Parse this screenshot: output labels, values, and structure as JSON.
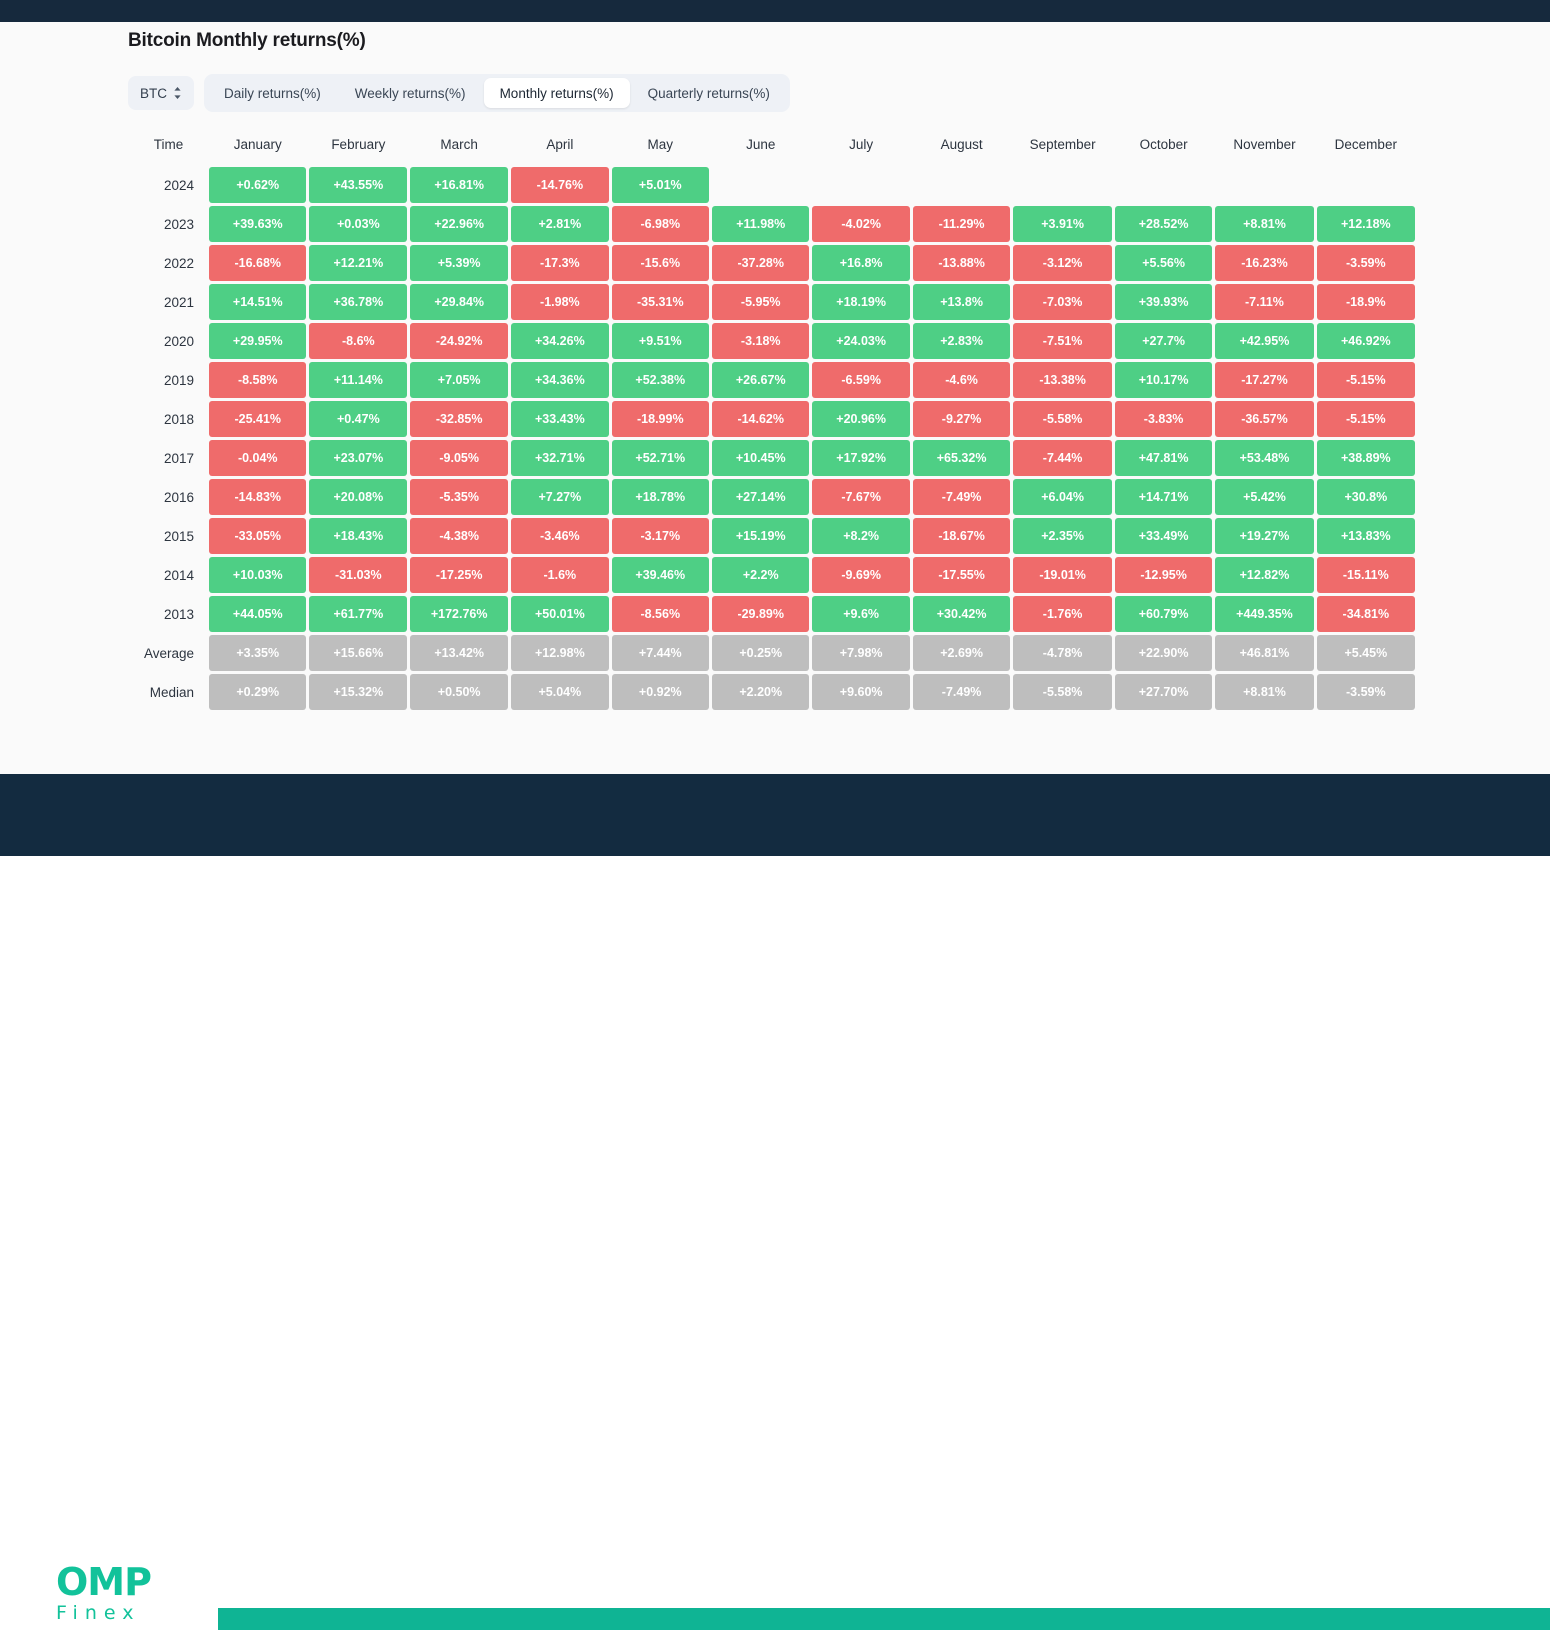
{
  "title": "Bitcoin Monthly returns(%)",
  "controls": {
    "asset": "BTC",
    "asset_icon": "chevron-up-down-icon",
    "tabs": [
      {
        "label": "Daily returns(%)",
        "active": false
      },
      {
        "label": "Weekly returns(%)",
        "active": false
      },
      {
        "label": "Monthly returns(%)",
        "active": true
      },
      {
        "label": "Quarterly returns(%)",
        "active": false
      }
    ]
  },
  "colors": {
    "positive": "#4ecf85",
    "negative": "#ef6b6b",
    "stat": "#bebebe",
    "brand": "#12c29a",
    "navy": "#16293d",
    "teal_band": "#0fb494"
  },
  "logo": {
    "name": "OMP",
    "sub": "Finex"
  },
  "chart_data": {
    "type": "heatmap",
    "title": "Bitcoin Monthly returns(%)",
    "xlabel": "",
    "ylabel": "Time",
    "columns": [
      "Time",
      "January",
      "February",
      "March",
      "April",
      "May",
      "June",
      "July",
      "August",
      "September",
      "October",
      "November",
      "December"
    ],
    "categories": [
      "January",
      "February",
      "March",
      "April",
      "May",
      "June",
      "July",
      "August",
      "September",
      "October",
      "November",
      "December"
    ],
    "rows": [
      {
        "label": "2024",
        "kind": "year",
        "values": [
          "+0.62%",
          "+43.55%",
          "+16.81%",
          "-14.76%",
          "+5.01%",
          "",
          "",
          "",
          "",
          "",
          "",
          ""
        ]
      },
      {
        "label": "2023",
        "kind": "year",
        "values": [
          "+39.63%",
          "+0.03%",
          "+22.96%",
          "+2.81%",
          "-6.98%",
          "+11.98%",
          "-4.02%",
          "-11.29%",
          "+3.91%",
          "+28.52%",
          "+8.81%",
          "+12.18%"
        ]
      },
      {
        "label": "2022",
        "kind": "year",
        "values": [
          "-16.68%",
          "+12.21%",
          "+5.39%",
          "-17.3%",
          "-15.6%",
          "-37.28%",
          "+16.8%",
          "-13.88%",
          "-3.12%",
          "+5.56%",
          "-16.23%",
          "-3.59%"
        ]
      },
      {
        "label": "2021",
        "kind": "year",
        "values": [
          "+14.51%",
          "+36.78%",
          "+29.84%",
          "-1.98%",
          "-35.31%",
          "-5.95%",
          "+18.19%",
          "+13.8%",
          "-7.03%",
          "+39.93%",
          "-7.11%",
          "-18.9%"
        ]
      },
      {
        "label": "2020",
        "kind": "year",
        "values": [
          "+29.95%",
          "-8.6%",
          "-24.92%",
          "+34.26%",
          "+9.51%",
          "-3.18%",
          "+24.03%",
          "+2.83%",
          "-7.51%",
          "+27.7%",
          "+42.95%",
          "+46.92%"
        ]
      },
      {
        "label": "2019",
        "kind": "year",
        "values": [
          "-8.58%",
          "+11.14%",
          "+7.05%",
          "+34.36%",
          "+52.38%",
          "+26.67%",
          "-6.59%",
          "-4.6%",
          "-13.38%",
          "+10.17%",
          "-17.27%",
          "-5.15%"
        ]
      },
      {
        "label": "2018",
        "kind": "year",
        "values": [
          "-25.41%",
          "+0.47%",
          "-32.85%",
          "+33.43%",
          "-18.99%",
          "-14.62%",
          "+20.96%",
          "-9.27%",
          "-5.58%",
          "-3.83%",
          "-36.57%",
          "-5.15%"
        ]
      },
      {
        "label": "2017",
        "kind": "year",
        "values": [
          "-0.04%",
          "+23.07%",
          "-9.05%",
          "+32.71%",
          "+52.71%",
          "+10.45%",
          "+17.92%",
          "+65.32%",
          "-7.44%",
          "+47.81%",
          "+53.48%",
          "+38.89%"
        ]
      },
      {
        "label": "2016",
        "kind": "year",
        "values": [
          "-14.83%",
          "+20.08%",
          "-5.35%",
          "+7.27%",
          "+18.78%",
          "+27.14%",
          "-7.67%",
          "-7.49%",
          "+6.04%",
          "+14.71%",
          "+5.42%",
          "+30.8%"
        ]
      },
      {
        "label": "2015",
        "kind": "year",
        "values": [
          "-33.05%",
          "+18.43%",
          "-4.38%",
          "-3.46%",
          "-3.17%",
          "+15.19%",
          "+8.2%",
          "-18.67%",
          "+2.35%",
          "+33.49%",
          "+19.27%",
          "+13.83%"
        ]
      },
      {
        "label": "2014",
        "kind": "year",
        "values": [
          "+10.03%",
          "-31.03%",
          "-17.25%",
          "-1.6%",
          "+39.46%",
          "+2.2%",
          "-9.69%",
          "-17.55%",
          "-19.01%",
          "-12.95%",
          "+12.82%",
          "-15.11%"
        ]
      },
      {
        "label": "2013",
        "kind": "year",
        "values": [
          "+44.05%",
          "+61.77%",
          "+172.76%",
          "+50.01%",
          "-8.56%",
          "-29.89%",
          "+9.6%",
          "+30.42%",
          "-1.76%",
          "+60.79%",
          "+449.35%",
          "-34.81%"
        ]
      },
      {
        "label": "Average",
        "kind": "stat",
        "values": [
          "+3.35%",
          "+15.66%",
          "+13.42%",
          "+12.98%",
          "+7.44%",
          "+0.25%",
          "+7.98%",
          "+2.69%",
          "-4.78%",
          "+22.90%",
          "+46.81%",
          "+5.45%"
        ]
      },
      {
        "label": "Median",
        "kind": "stat",
        "values": [
          "+0.29%",
          "+15.32%",
          "+0.50%",
          "+5.04%",
          "+0.92%",
          "+2.20%",
          "+9.60%",
          "-7.49%",
          "-5.58%",
          "+27.70%",
          "+8.81%",
          "-3.59%"
        ]
      }
    ]
  }
}
